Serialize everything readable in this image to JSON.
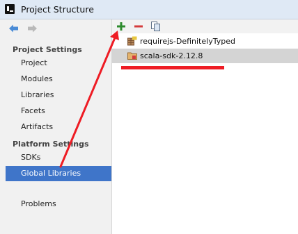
{
  "window": {
    "title": "Project Structure"
  },
  "navigation": {
    "back_icon": "back-arrow-icon",
    "forward_icon": "forward-arrow-icon"
  },
  "sidebar": {
    "sections": [
      {
        "header": "Project Settings",
        "items": [
          "Project",
          "Modules",
          "Libraries",
          "Facets",
          "Artifacts"
        ]
      },
      {
        "header": "Platform Settings",
        "items": [
          "SDKs",
          "Global Libraries"
        ]
      }
    ],
    "extra_items": [
      "Problems"
    ],
    "selected_item": "Global Libraries"
  },
  "toolbar": {
    "add_icon": "plus-icon",
    "remove_icon": "minus-icon",
    "copy_icon": "copy-icon"
  },
  "libraries": [
    {
      "name": "requirejs-DefinitelyTyped",
      "icon": "js-library-icon",
      "selected": false
    },
    {
      "name": "scala-sdk-2.12.8",
      "icon": "scala-folder-icon",
      "selected": true
    }
  ],
  "colors": {
    "selection": "#3f75c9",
    "annotation": "#ee1c24",
    "add": "#2e8b2e",
    "remove": "#d43c3c"
  }
}
